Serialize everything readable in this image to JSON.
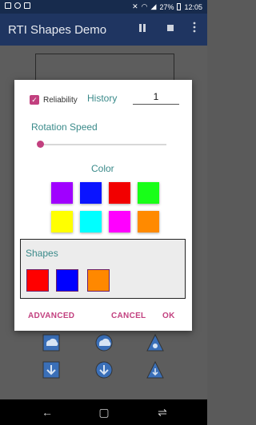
{
  "status_bar": {
    "battery": "27%",
    "time": "12:05"
  },
  "app_bar": {
    "title": "RTI Shapes Demo",
    "pause_icon": "pause-icon",
    "stop_icon": "stop-icon",
    "more_icon": "more-vert-icon"
  },
  "dialog": {
    "reliability_label": "Reliability",
    "reliability_checked": true,
    "history_label": "History",
    "history_value": "1",
    "rotation_label": "Rotation Speed",
    "rotation_value": 0,
    "color_label": "Color",
    "colors": [
      "#a000ff",
      "#0a14ff",
      "#f20000",
      "#18ff18",
      "#ffff00",
      "#00ffff",
      "#ff00ff",
      "#ff8a00"
    ],
    "shapes_label": "Shapes",
    "shapes": [
      "#ff0000",
      "#0000ff",
      "#ff8800"
    ],
    "advanced_label": "ADVANCED",
    "cancel_label": "CANCEL",
    "ok_label": "OK"
  }
}
